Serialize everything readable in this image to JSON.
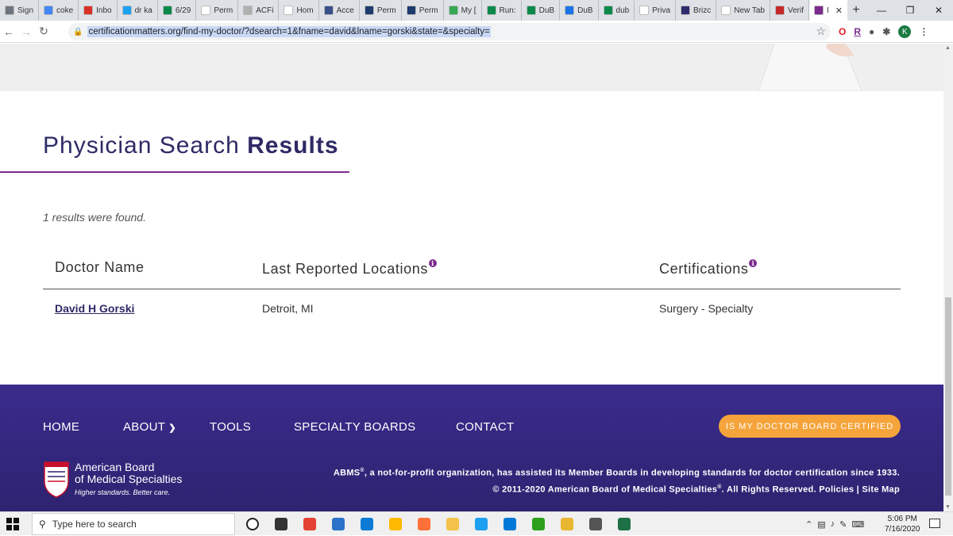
{
  "browser": {
    "tabs": [
      {
        "label": "Sign",
        "color": "#6c757d"
      },
      {
        "label": "coke",
        "color": "#4285f4"
      },
      {
        "label": "Inbo",
        "color": "#d93025"
      },
      {
        "label": "dr ka",
        "color": "#1da1f2"
      },
      {
        "label": "6/29",
        "color": "#0a8a4a"
      },
      {
        "label": "Perm",
        "color": "#ffffff"
      },
      {
        "label": "ACFi",
        "color": "#b0b0b0"
      },
      {
        "label": "Hom",
        "color": "#ffffff"
      },
      {
        "label": "Acce",
        "color": "#3a4e8c"
      },
      {
        "label": "Perm",
        "color": "#1d3b6e"
      },
      {
        "label": "Perm",
        "color": "#1d3b6e"
      },
      {
        "label": "My [",
        "color": "#34a853"
      },
      {
        "label": "Run:",
        "color": "#0a8a4a"
      },
      {
        "label": "DuB",
        "color": "#0a8a4a"
      },
      {
        "label": "DuB",
        "color": "#1a73e8"
      },
      {
        "label": "dub",
        "color": "#0a8a4a"
      },
      {
        "label": "Priva",
        "color": "#ffffff"
      },
      {
        "label": "Brizc",
        "color": "#2d2d6e"
      },
      {
        "label": "New Tab",
        "color": "#ffffff"
      },
      {
        "label": "Verif",
        "color": "#c62828"
      },
      {
        "label": "I",
        "color": "#7d2b8f"
      }
    ],
    "url": "certificationmatters.org/find-my-doctor/?dsearch=1&fname=david&lname=gorski&state=&specialty=",
    "new_tab_symbol": "+",
    "avatar_letter": "K",
    "ext_r_label": "R"
  },
  "page": {
    "title_light": "Physician Search",
    "title_bold": "Results",
    "result_count": "1 results were found.",
    "columns": {
      "doctor": "Doctor Name",
      "locations": "Last Reported Locations",
      "certifications": "Certifications"
    },
    "row": {
      "doctor": "David H Gorski",
      "location": "Detroit, MI",
      "certification": "Surgery - Specialty"
    },
    "info_glyph": "i"
  },
  "footer": {
    "nav": [
      "HOME",
      "ABOUT",
      "TOOLS",
      "SPECIALTY BOARDS",
      "CONTACT"
    ],
    "about_caret": "⌄",
    "cta": "IS MY DOCTOR BOARD CERTIFIED",
    "org_line1": "American Board",
    "org_line2": "of Medical Specialties",
    "tagline": "Higher standards. Better care.",
    "legal_line1": "ABMS",
    "legal_line1_rest": ", a not-for-profit organization, has assisted its Member Boards in developing standards for doctor certification since 1933.",
    "legal_line2": "© 2011-2020 American Board of Medical Specialties",
    "legal_line2_rest": ". All Rights Reserved. Policies | Site Map",
    "registered": "®"
  },
  "taskbar": {
    "search_placeholder": "Type here to search",
    "time": "5:06 PM",
    "date": "7/16/2020",
    "icons": [
      "cortana-icon",
      "task-view-icon",
      "chrome-icon",
      "media-player-icon",
      "edge-icon",
      "store-icon",
      "firefox-icon",
      "folder-icon",
      "ie-icon",
      "mail-icon",
      "quickbooks-icon",
      "file-explorer-icon",
      "settings-icon",
      "excel-icon"
    ],
    "icon_colors": [
      "#ffffff",
      "#333333",
      "#e34133",
      "#2a73c9",
      "#0c7bd6",
      "#ffb900",
      "#ff7139",
      "#f3c24a",
      "#1ea0f0",
      "#0078d7",
      "#2ca01c",
      "#e8b631",
      "#555555",
      "#1e7145"
    ]
  },
  "colors": {
    "brand_navy": "#2e2a66",
    "accent_purple": "#7d2b8f",
    "footer_bg": "#3a2b8c",
    "cta_orange": "#f5a43b"
  }
}
